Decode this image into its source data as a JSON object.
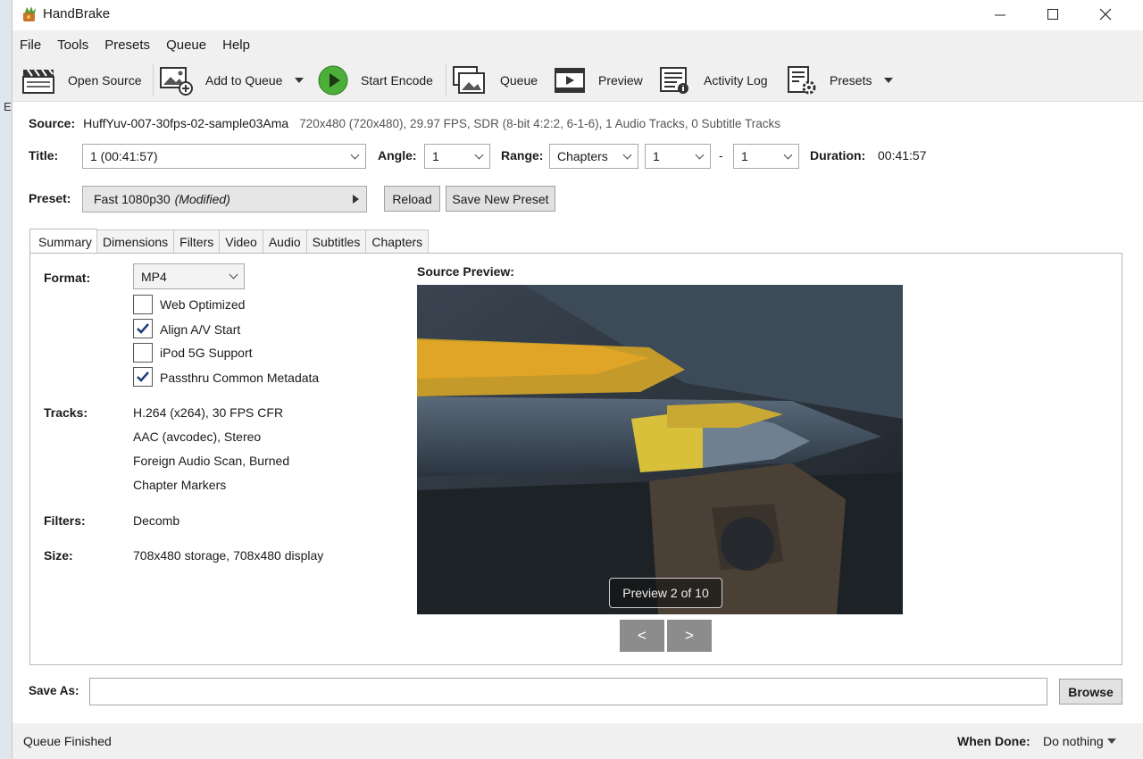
{
  "window": {
    "title": "HandBrake",
    "left_strip_text": "E"
  },
  "menu": {
    "items": [
      "File",
      "Tools",
      "Presets",
      "Queue",
      "Help"
    ]
  },
  "toolbar": {
    "open_source": "Open Source",
    "add_to_queue": "Add to Queue",
    "start_encode": "Start Encode",
    "queue": "Queue",
    "preview": "Preview",
    "activity_log": "Activity Log",
    "presets": "Presets"
  },
  "source": {
    "label": "Source:",
    "name": "HuffYuv-007-30fps-02-sample03Ama",
    "info": "720x480 (720x480), 29.97 FPS, SDR (8-bit 4:2:2, 6-1-6), 1 Audio Tracks, 0 Subtitle Tracks"
  },
  "title_row": {
    "title_label": "Title:",
    "title_value": "1  (00:41:57)",
    "angle_label": "Angle:",
    "angle_value": "1",
    "range_label": "Range:",
    "range_value": "Chapters",
    "range_start": "1",
    "range_dash": "-",
    "range_end": "1",
    "duration_label": "Duration:",
    "duration_value": "00:41:57"
  },
  "preset_row": {
    "label": "Preset:",
    "value": "Fast 1080p30",
    "modified": "(Modified)",
    "reload": "Reload",
    "save_new": "Save New Preset"
  },
  "tabs": [
    "Summary",
    "Dimensions",
    "Filters",
    "Video",
    "Audio",
    "Subtitles",
    "Chapters"
  ],
  "summary": {
    "format_label": "Format:",
    "format_value": "MP4",
    "options": [
      {
        "label": "Web Optimized",
        "checked": false
      },
      {
        "label": "Align A/V Start",
        "checked": true
      },
      {
        "label": "iPod 5G Support",
        "checked": false
      },
      {
        "label": "Passthru Common Metadata",
        "checked": true
      }
    ],
    "tracks_label": "Tracks:",
    "tracks": [
      "H.264 (x264), 30 FPS CFR",
      "AAC (avcodec), Stereo",
      "Foreign Audio Scan, Burned",
      "Chapter Markers"
    ],
    "filters_label": "Filters:",
    "filters_value": "Decomb",
    "size_label": "Size:",
    "size_value": "708x480 storage, 708x480 display",
    "preview_label": "Source Preview:",
    "preview_badge": "Preview 2 of 10",
    "prev_button": "<",
    "next_button": ">"
  },
  "save_as": {
    "label": "Save As:",
    "value": "",
    "browse": "Browse"
  },
  "status": {
    "text": "Queue Finished",
    "when_done_label": "When Done:",
    "when_done_value": "Do nothing"
  }
}
